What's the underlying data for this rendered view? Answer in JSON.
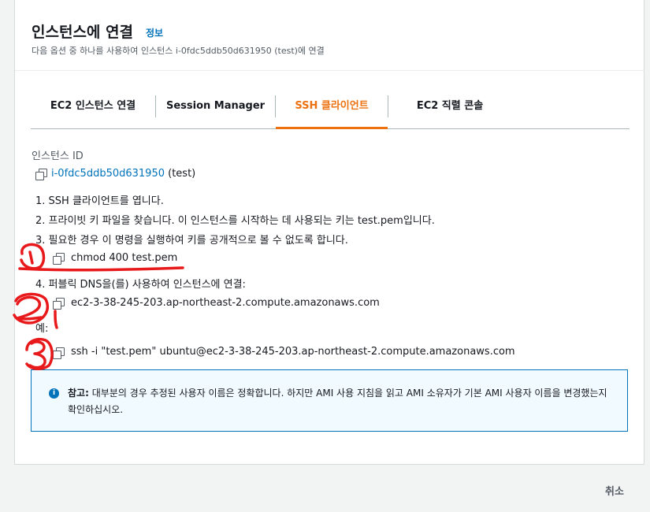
{
  "header": {
    "title": "인스턴스에 연결",
    "info_link": "정보",
    "subtitle": "다음 옵션 중 하나를 사용하여 인스턴스 i-0fdc5ddb50d631950 (test)에 연결"
  },
  "tabs": [
    {
      "label": "EC2 인스턴스 연결"
    },
    {
      "label": "Session Manager"
    },
    {
      "label": "SSH 클라이언트"
    },
    {
      "label": "EC2 직렬 콘솔"
    }
  ],
  "instance": {
    "label": "인스턴스 ID",
    "id": "i-0fdc5ddb50d631950",
    "name": "(test)"
  },
  "steps": [
    "1. SSH 클라이언트를 엽니다.",
    "2. 프라이빗 키 파일을 찾습니다. 이 인스턴스를 시작하는 데 사용되는 키는 test.pem입니다.",
    "3. 필요한 경우 이 명령을 실행하여 키를 공개적으로 볼 수 없도록 합니다.",
    "4. 퍼블릭 DNS을(를) 사용하여 인스턴스에 연결:"
  ],
  "commands": {
    "chmod": "chmod 400 test.pem",
    "dns": "ec2-3-38-245-203.ap-northeast-2.compute.amazonaws.com",
    "example_label": "예:",
    "ssh": "ssh -i \"test.pem\" ubuntu@ec2-3-38-245-203.ap-northeast-2.compute.amazonaws.com"
  },
  "alert": {
    "prefix": "참고:",
    "text": " 대부분의 경우 추정된 사용자 이름은 정확합니다. 하지만 AMI 사용 지침을 읽고 AMI 소유자가 기본 AMI 사용자 이름을 변경했는지 확인하십시오."
  },
  "footer": {
    "cancel": "취소"
  },
  "colors": {
    "accent": "#ec7211",
    "link": "#0073bb",
    "annotation": "#e8191b"
  },
  "icons": [
    "copy-icon",
    "info-icon"
  ]
}
